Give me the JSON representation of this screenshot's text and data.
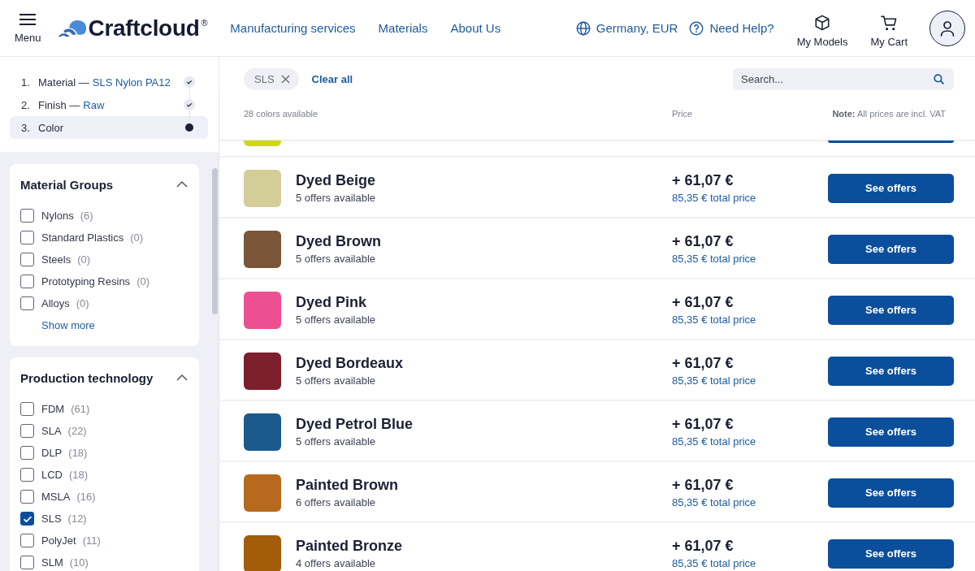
{
  "header": {
    "menu_label": "Menu",
    "logo": "Craftcloud$^{®}$",
    "nav": [
      "Manufacturing services",
      "Materials",
      "About Us"
    ],
    "region": "Germany, EUR",
    "help": "Need Help?",
    "models": "My Models",
    "cart": "My Cart"
  },
  "steps": [
    {
      "number": "1.",
      "label": "Material —",
      "value": "SLS Nylon PA12",
      "done": true,
      "selected": false
    },
    {
      "number": "2.",
      "label": "Finish —",
      "value": "Raw",
      "done": true,
      "selected": false
    },
    {
      "number": "3.",
      "label": "Color",
      "done": false,
      "selected": true
    }
  ],
  "filters": [
    {
      "title": "Material Groups",
      "expanded": true,
      "options": [
        {
          "label": "Nylons",
          "count": "(6)",
          "checked": false
        },
        {
          "label": "Standard Plastics",
          "count": "(0)",
          "checked": false
        },
        {
          "label": "Steels",
          "count": "(0)",
          "checked": false
        },
        {
          "label": "Prototyping Resins",
          "count": "(0)",
          "checked": false
        },
        {
          "label": "Alloys",
          "count": "(0)",
          "checked": false
        }
      ],
      "more": "Show more"
    },
    {
      "title": "Production technology",
      "expanded": true,
      "options": [
        {
          "label": "FDM",
          "count": "(61)",
          "checked": false
        },
        {
          "label": "SLA",
          "count": "(22)",
          "checked": false
        },
        {
          "label": "DLP",
          "count": "(18)",
          "checked": false
        },
        {
          "label": "LCD",
          "count": "(18)",
          "checked": false
        },
        {
          "label": "MSLA",
          "count": "(16)",
          "checked": false
        },
        {
          "label": "SLS",
          "count": "(12)",
          "checked": true
        },
        {
          "label": "PolyJet",
          "count": "(11)",
          "checked": false
        },
        {
          "label": "SLM",
          "count": "(10)",
          "checked": false
        }
      ]
    }
  ],
  "active_filters": [
    {
      "label": "SLS"
    }
  ],
  "clear_all": "Clear all",
  "search": {
    "placeholder": "Search..."
  },
  "list_header": {
    "count": "28 colors available",
    "price": "Price",
    "note": "**Note:** All prices are incl. VAT"
  },
  "partial_row": {
    "color": "#cfd61c"
  },
  "rows": [
    {
      "name": "Dyed Beige",
      "offers": "5 offers available",
      "price": "+ 61,07 €",
      "total": "85,35 € total price",
      "color": "#d3cd98",
      "button": "See offers"
    },
    {
      "name": "Dyed Brown",
      "offers": "5 offers available",
      "price": "+ 61,07 €",
      "total": "85,35 € total price",
      "color": "#7b5538",
      "button": "See offers"
    },
    {
      "name": "Dyed Pink",
      "offers": "5 offers available",
      "price": "+ 61,07 €",
      "total": "85,35 € total price",
      "color": "#ec5090",
      "button": "See offers"
    },
    {
      "name": "Dyed Bordeaux",
      "offers": "5 offers available",
      "price": "+ 61,07 €",
      "total": "85,35 € total price",
      "color": "#7d1f2c",
      "button": "See offers"
    },
    {
      "name": "Dyed Petrol Blue",
      "offers": "5 offers available",
      "price": "+ 61,07 €",
      "total": "85,35 € total price",
      "color": "#1c5a8e",
      "button": "See offers"
    },
    {
      "name": "Painted Brown",
      "offers": "6 offers available",
      "price": "+ 61,07 €",
      "total": "85,35 € total price",
      "color": "#b76a1e",
      "button": "See offers"
    },
    {
      "name": "Painted Bronze",
      "offers": "4 offers available",
      "price": "+ 61,07 €",
      "total": "85,35 € total price",
      "color": "#a25c0a",
      "button": "See offers"
    }
  ]
}
